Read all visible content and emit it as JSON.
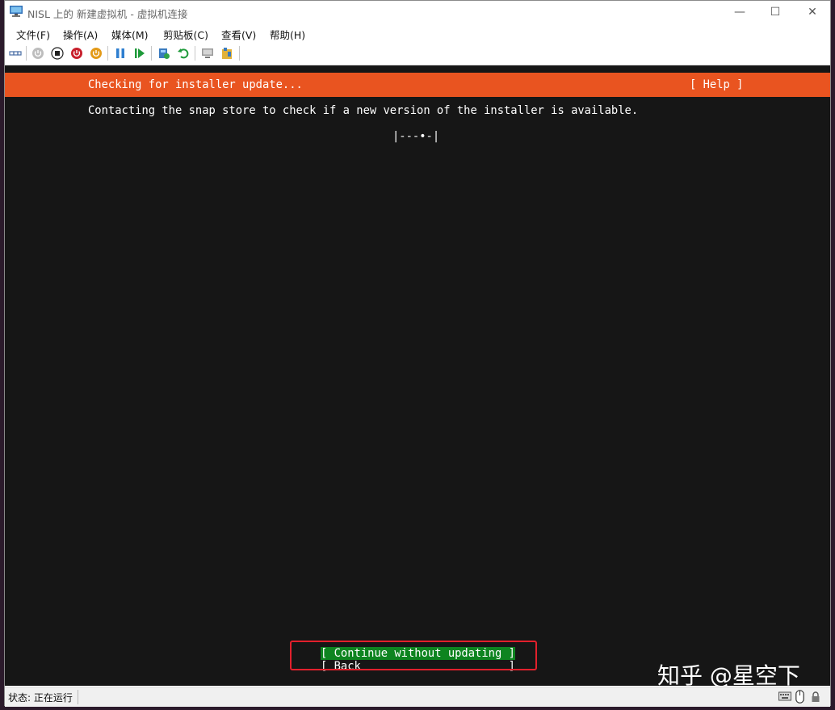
{
  "window": {
    "title": "NISL 上的 新建虚拟机 - 虚拟机连接",
    "controls": {
      "minimize": "—",
      "maximize": "☐",
      "close": "✕"
    }
  },
  "menu": [
    "文件(F)",
    "操作(A)",
    "媒体(M)",
    "剪贴板(C)",
    "查看(V)",
    "帮助(H)"
  ],
  "toolbar": {
    "buttons": [
      "ctrl-alt-del-icon",
      "start-icon",
      "turn-off-icon",
      "shut-down-icon",
      "save-icon",
      "pause-icon",
      "reset-icon",
      "checkpoint-icon",
      "revert-icon",
      "enhanced-session-icon",
      "share-icon"
    ]
  },
  "installer": {
    "header_title": "Checking for installer update...",
    "help_label": "[ Help ]",
    "message": "Contacting the snap store to check if a new version of the installer is available.",
    "spinner": "|---•-|",
    "continue_label": "[ Continue without updating ]",
    "back_label": "[ Back                      ]",
    "colors": {
      "header": "#e95420",
      "selected": "#0e8420",
      "background": "#161616",
      "highlight": "#e2202c"
    }
  },
  "watermark": "知乎 @星空下",
  "statusbar": {
    "status": "状态: 正在运行"
  }
}
